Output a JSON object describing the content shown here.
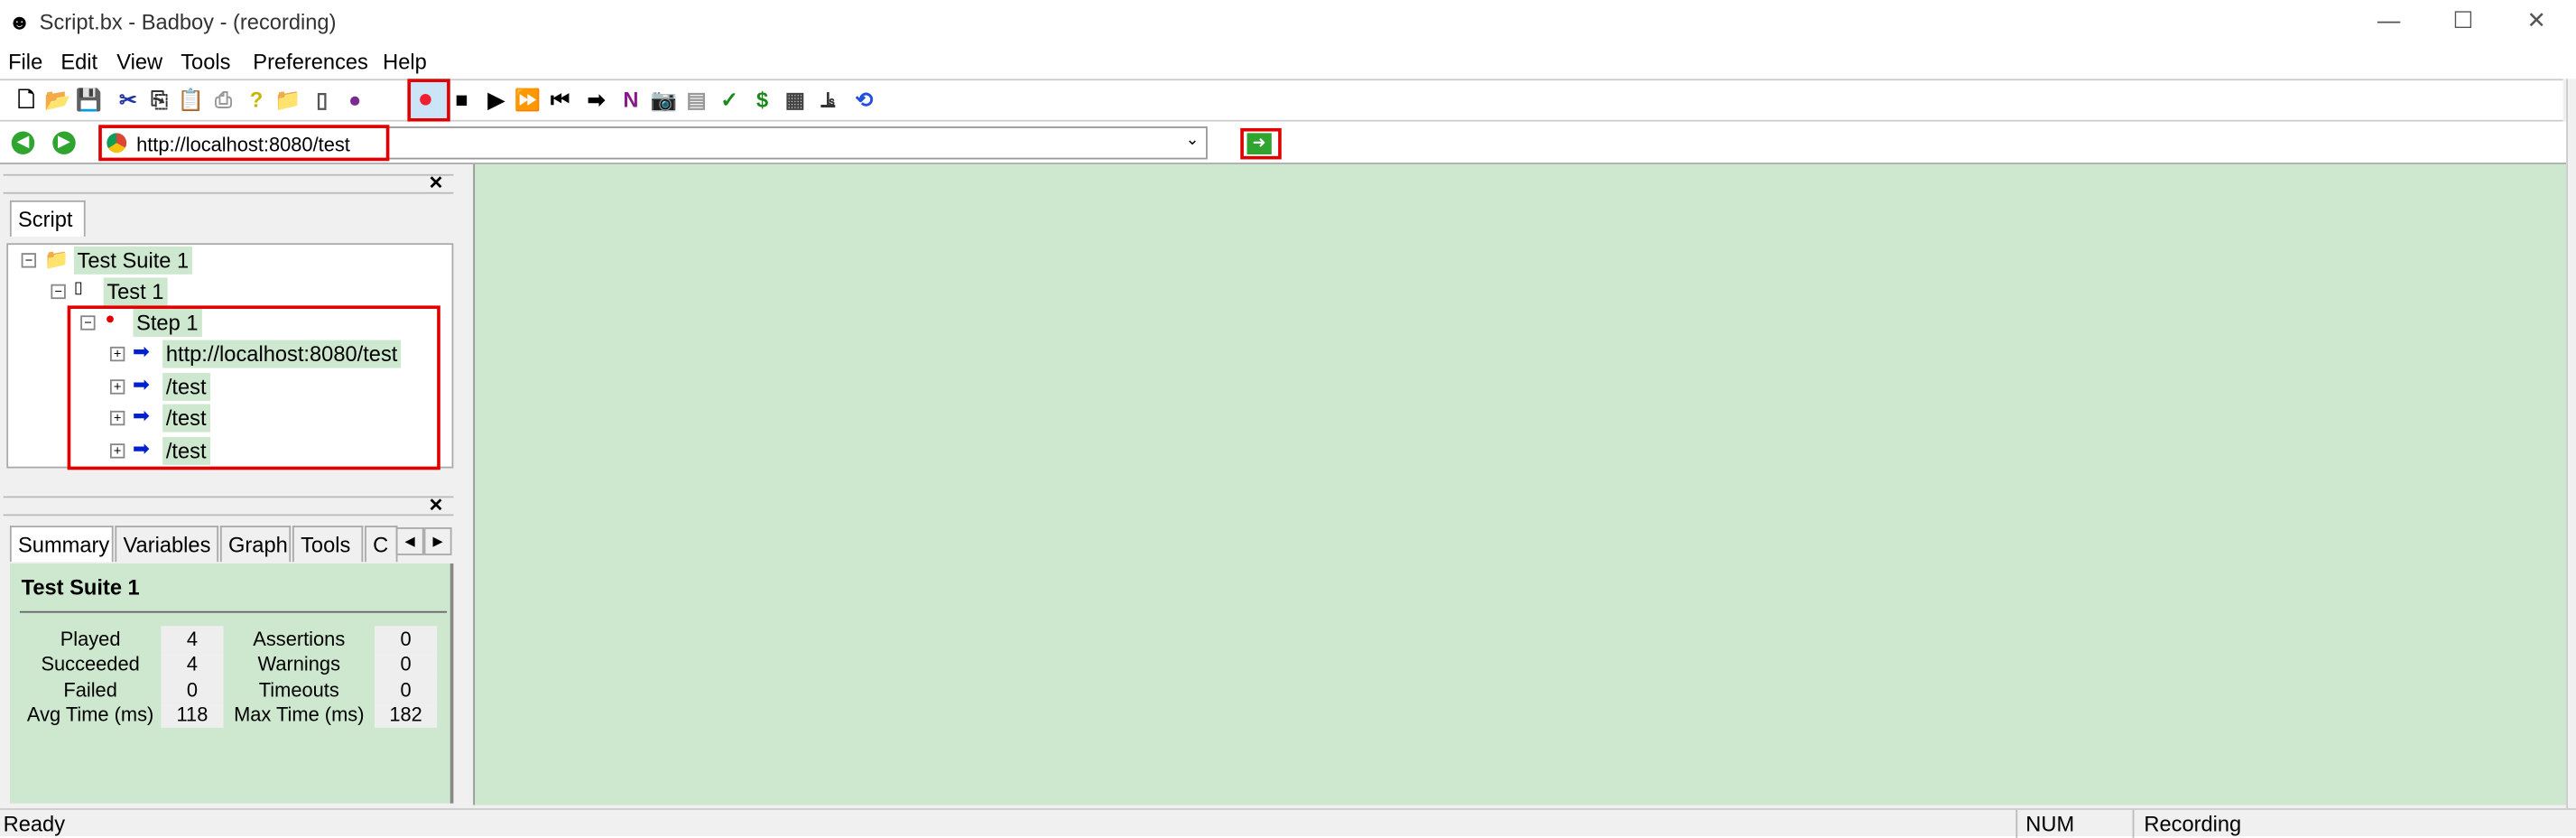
{
  "window": {
    "title": "Script.bx - Badboy - (recording)",
    "minimize": "—",
    "maximize": "☐",
    "close": "✕"
  },
  "menu": [
    "File",
    "Edit",
    "View",
    "Tools",
    "Preferences",
    "Help"
  ],
  "toolbar": [
    {
      "icon": "new-icon",
      "g": "🗋",
      "c": "#000"
    },
    {
      "icon": "open-icon",
      "g": "📂",
      "c": "#8a7a00"
    },
    {
      "icon": "save-icon",
      "g": "💾",
      "c": "#444"
    },
    {
      "icon": "cut-icon",
      "g": "✂",
      "c": "#2233aa"
    },
    {
      "icon": "copy-icon",
      "g": "⎘",
      "c": "#333"
    },
    {
      "icon": "paste-icon",
      "g": "📋",
      "c": "#555"
    },
    {
      "icon": "print-icon",
      "g": "⎙",
      "c": "#999"
    },
    {
      "icon": "help-icon",
      "g": "?",
      "c": "#c8b400"
    },
    {
      "icon": "add-suite-icon",
      "g": "📁",
      "c": "#e0b000"
    },
    {
      "icon": "add-test-icon",
      "g": "▯",
      "c": "#555"
    },
    {
      "icon": "add-step-icon",
      "g": "●",
      "c": "#7a2a90"
    },
    {
      "icon": "record-icon",
      "g": "●",
      "c": "#f02030"
    },
    {
      "icon": "stop-icon",
      "g": "■",
      "c": "#000"
    },
    {
      "icon": "play-icon",
      "g": "▶",
      "c": "#000"
    },
    {
      "icon": "play-all-icon",
      "g": "⏩",
      "c": "#000"
    },
    {
      "icon": "rewind-icon",
      "g": "⏮",
      "c": "#000"
    },
    {
      "icon": "step-forward-icon",
      "g": "➡",
      "c": "#000"
    },
    {
      "icon": "navigation-icon",
      "g": "N",
      "c": "#8a1a8a"
    },
    {
      "icon": "screenshot-icon",
      "g": "📷",
      "c": "#333"
    },
    {
      "icon": "report-icon",
      "g": "▤",
      "c": "#999"
    },
    {
      "icon": "assertion-icon",
      "g": "✓",
      "c": "#1a8a1a"
    },
    {
      "icon": "variable-icon",
      "g": "$",
      "c": "#1a8a1a"
    },
    {
      "icon": "table-icon",
      "g": "▦",
      "c": "#444"
    },
    {
      "icon": "timer-icon",
      "g": "⫡",
      "c": "#333"
    },
    {
      "icon": "refresh-icon",
      "g": "⟲",
      "c": "#2050e0"
    }
  ],
  "address": {
    "url": "http://localhost:8080/test",
    "go_icon": "go-arrow-icon",
    "back_icon": "back-icon",
    "forward_icon": "forward-icon"
  },
  "script_pane": {
    "tab": "Script",
    "tree": {
      "suite": "Test Suite 1",
      "test": "Test 1",
      "step": "Step 1",
      "requests": [
        "http://localhost:8080/test",
        "/test",
        "/test",
        "/test"
      ]
    }
  },
  "bottom_pane": {
    "tabs": [
      "Summary",
      "Variables",
      "Graph",
      "Tools",
      "C"
    ],
    "summary": {
      "title": "Test Suite 1",
      "rows": [
        {
          "l1": "Played",
          "v1": "4",
          "l2": "Assertions",
          "v2": "0"
        },
        {
          "l1": "Succeeded",
          "v1": "4",
          "l2": "Warnings",
          "v2": "0"
        },
        {
          "l1": "Failed",
          "v1": "0",
          "l2": "Timeouts",
          "v2": "0"
        },
        {
          "l1": "Avg Time (ms)",
          "v1": "118",
          "l2": "Max Time (ms)",
          "v2": "182"
        }
      ]
    }
  },
  "status": {
    "left": "Ready",
    "num": "NUM",
    "mode": "Recording"
  },
  "colors": {
    "content_bg": "#cde8cf",
    "highlight": "#e00000"
  }
}
